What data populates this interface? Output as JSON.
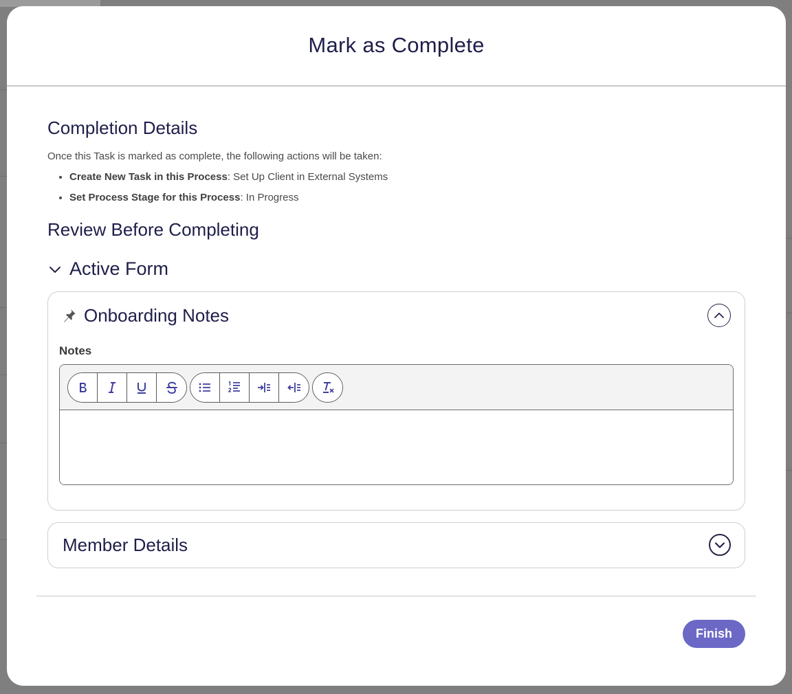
{
  "modal": {
    "title": "Mark as Complete"
  },
  "completion": {
    "heading": "Completion Details",
    "intro": "Once this Task is marked as complete, the following actions will be taken:",
    "actions": [
      {
        "label": "Create New Task in this Process",
        "value": ": Set Up Client in External Systems"
      },
      {
        "label": "Set Process Stage for this Process",
        "value": ": In Progress"
      }
    ]
  },
  "review": {
    "heading": "Review Before Completing",
    "active_form_label": "Active Form"
  },
  "onboarding": {
    "title": "Onboarding Notes",
    "notes_label": "Notes",
    "notes_value": ""
  },
  "toolbar": {
    "icons": [
      "bold-icon",
      "italic-icon",
      "underline-icon",
      "strikethrough-icon",
      "bullet-list-icon",
      "numbered-list-icon",
      "indent-icon",
      "outdent-icon",
      "clear-format-icon"
    ]
  },
  "member": {
    "title": "Member Details"
  },
  "footer": {
    "finish_label": "Finish"
  },
  "colors": {
    "accent": "#6b68c6",
    "text_dark": "#1e1e4a",
    "backdrop": "#7f7f7f"
  }
}
